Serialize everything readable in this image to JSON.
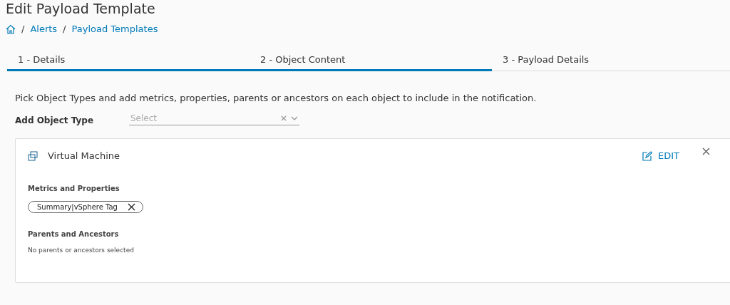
{
  "page": {
    "title": "Edit Payload Template"
  },
  "breadcrumb": [
    {
      "separator": "/",
      "label": "Alerts"
    },
    {
      "separator": "/",
      "label": "Payload Templates"
    }
  ],
  "steps": [
    {
      "label": "1 - Details",
      "complete": true
    },
    {
      "label": "2 - Object Content",
      "complete": true
    },
    {
      "label": "3 - Payload Details",
      "complete": false
    }
  ],
  "instructions": "Pick Object Types and add metrics, properties, parents or ancestors on each object to include in the notification.",
  "add_object_type": {
    "label": "Add Object Type",
    "placeholder": "Select"
  },
  "object_card": {
    "title": "Virtual Machine",
    "edit_label": "EDIT",
    "metrics_heading": "Metrics and Properties",
    "metrics": [
      "Summary|vSphere Tag"
    ],
    "parents_heading": "Parents and Ancestors",
    "parents_empty": "No parents or ancestors selected"
  }
}
